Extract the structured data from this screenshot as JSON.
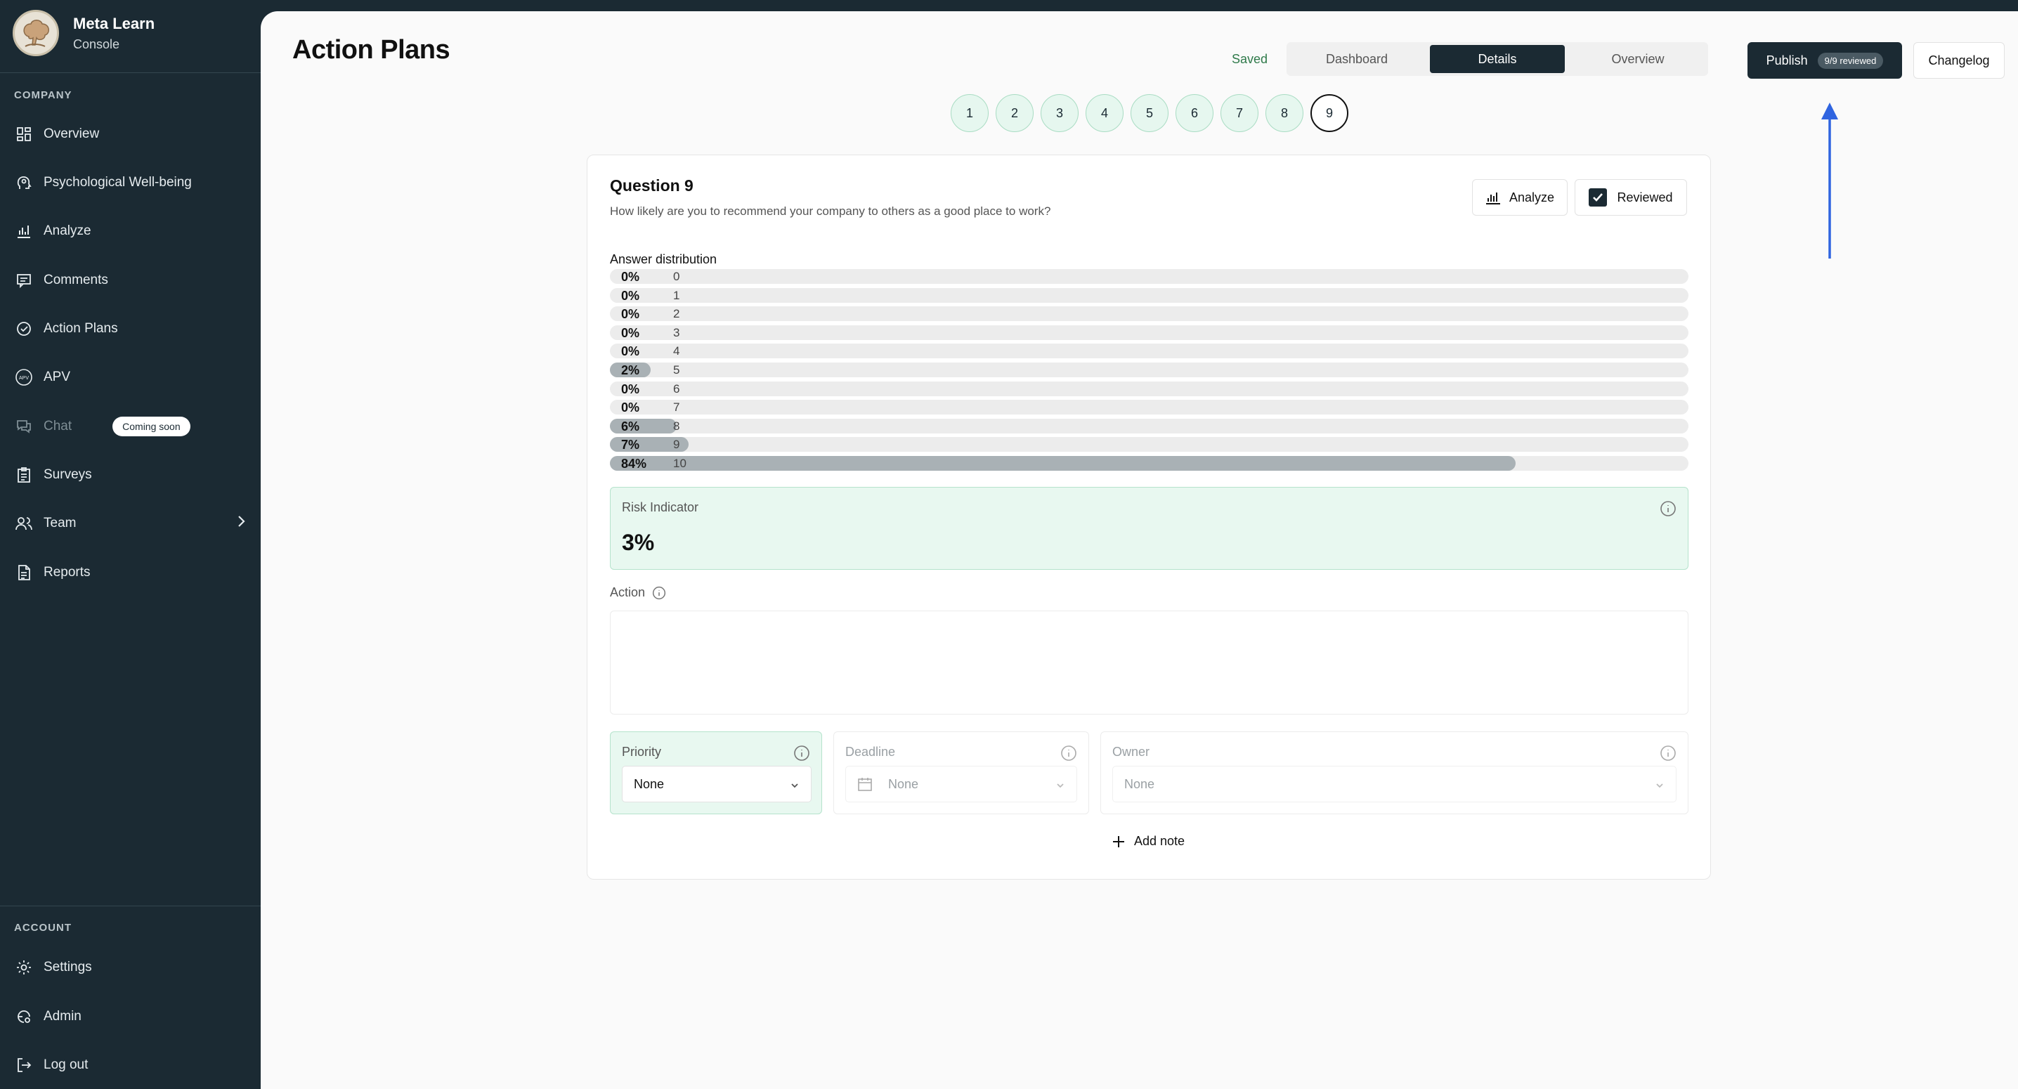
{
  "brand": {
    "name": "Meta Learn",
    "sub": "Console"
  },
  "sidebar": {
    "company_label": "COMPANY",
    "items": [
      {
        "label": "Overview",
        "icon": "dashboard-icon"
      },
      {
        "label": "Psychological Well-being",
        "icon": "head-icon"
      },
      {
        "label": "Analyze",
        "icon": "bar-chart-icon"
      },
      {
        "label": "Comments",
        "icon": "comment-icon"
      },
      {
        "label": "Action Plans",
        "icon": "check-circle-icon"
      },
      {
        "label": "APV",
        "icon": "apv-icon"
      },
      {
        "label": "Chat",
        "icon": "chat-icon",
        "badge": "Coming soon"
      },
      {
        "label": "Surveys",
        "icon": "clipboard-icon"
      },
      {
        "label": "Team",
        "icon": "users-icon"
      },
      {
        "label": "Reports",
        "icon": "document-icon"
      }
    ],
    "account_label": "ACCOUNT",
    "account_items": [
      {
        "label": "Settings",
        "icon": "gear-icon"
      },
      {
        "label": "Admin",
        "icon": "admin-icon"
      },
      {
        "label": "Log out",
        "icon": "logout-icon"
      }
    ]
  },
  "header": {
    "title": "Action Plans",
    "saved": "Saved",
    "tabs": [
      {
        "label": "Dashboard"
      },
      {
        "label": "Details"
      },
      {
        "label": "Overview"
      }
    ],
    "publish_label": "Publish",
    "publish_badge": "9/9 reviewed",
    "changelog_label": "Changelog"
  },
  "steps": [
    "1",
    "2",
    "3",
    "4",
    "5",
    "6",
    "7",
    "8",
    "9"
  ],
  "current_step": "9",
  "question": {
    "title": "Question 9",
    "text": "How likely are you to recommend your company to others as a good place to work?",
    "analyze_label": "Analyze",
    "reviewed_label": "Reviewed",
    "distribution_label": "Answer distribution",
    "distribution": [
      {
        "pct": "0%",
        "value": "0",
        "fraction": 0
      },
      {
        "pct": "0%",
        "value": "1",
        "fraction": 0
      },
      {
        "pct": "0%",
        "value": "2",
        "fraction": 0
      },
      {
        "pct": "0%",
        "value": "3",
        "fraction": 0
      },
      {
        "pct": "0%",
        "value": "4",
        "fraction": 0
      },
      {
        "pct": "2%",
        "value": "5",
        "fraction": 0.02
      },
      {
        "pct": "0%",
        "value": "6",
        "fraction": 0
      },
      {
        "pct": "0%",
        "value": "7",
        "fraction": 0
      },
      {
        "pct": "6%",
        "value": "8",
        "fraction": 0.06
      },
      {
        "pct": "7%",
        "value": "9",
        "fraction": 0.07
      },
      {
        "pct": "84%",
        "value": "10",
        "fraction": 0.84
      }
    ]
  },
  "risk": {
    "label": "Risk Indicator",
    "value": "3%"
  },
  "action": {
    "label": "Action",
    "value": ""
  },
  "fields": {
    "priority": {
      "label": "Priority",
      "value": "None"
    },
    "deadline": {
      "label": "Deadline",
      "value": "None"
    },
    "owner": {
      "label": "Owner",
      "value": "None"
    }
  },
  "add_note_label": "Add note",
  "colors": {
    "sidebar_bg": "#1b2a33",
    "accent_green_bg": "#e8f8f0",
    "annotation_arrow": "#2f64e0"
  }
}
